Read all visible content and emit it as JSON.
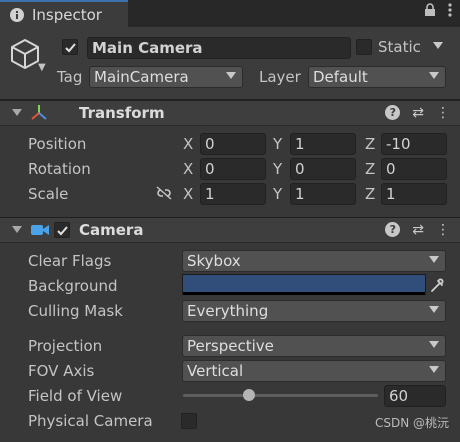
{
  "tab": {
    "title": "Inspector",
    "icon": "info-icon"
  },
  "tabbar": {
    "lock_icon": "lock-icon",
    "menu_icon": "kebab-menu-icon"
  },
  "gameobject": {
    "active": true,
    "name": "Main Camera",
    "static_label": "Static",
    "static_checked": false,
    "tag_label": "Tag",
    "tag_value": "MainCamera",
    "layer_label": "Layer",
    "layer_value": "Default"
  },
  "transform": {
    "title": "Transform",
    "position": {
      "label": "Position",
      "x": "0",
      "y": "1",
      "z": "-10"
    },
    "rotation": {
      "label": "Rotation",
      "x": "0",
      "y": "0",
      "z": "0"
    },
    "scale": {
      "label": "Scale",
      "x": "1",
      "y": "1",
      "z": "1"
    },
    "axes": {
      "x": "X",
      "y": "Y",
      "z": "Z"
    }
  },
  "camera": {
    "title": "Camera",
    "enabled": true,
    "clear_flags": {
      "label": "Clear Flags",
      "value": "Skybox"
    },
    "background": {
      "label": "Background",
      "color": "#314d7a"
    },
    "culling_mask": {
      "label": "Culling Mask",
      "value": "Everything"
    },
    "projection": {
      "label": "Projection",
      "value": "Perspective"
    },
    "fov_axis": {
      "label": "FOV Axis",
      "value": "Vertical"
    },
    "field_of_view": {
      "label": "Field of View",
      "value": "60",
      "slider_fraction": 0.34
    },
    "physical_camera": {
      "label": "Physical Camera",
      "checked": false
    }
  },
  "colors": {
    "accent": "#3a72b0",
    "panel": "#383838",
    "header": "#3e3e3e"
  },
  "watermark": "CSDN @桃沅"
}
